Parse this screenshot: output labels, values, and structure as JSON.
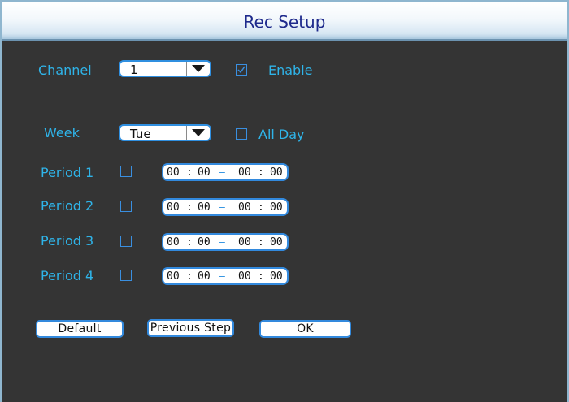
{
  "title": "Rec Setup",
  "channel": {
    "label": "Channel",
    "value": "1",
    "enable_label": "Enable",
    "enable_checked": true
  },
  "week": {
    "label": "Week",
    "value": "Tue",
    "all_day_label": "All Day",
    "all_day_checked": false
  },
  "time_separator": ":",
  "periods": [
    {
      "label": "Period 1",
      "checked": false,
      "start_h": "00",
      "start_m": "00",
      "end_h": "00",
      "end_m": "00"
    },
    {
      "label": "Period 2",
      "checked": false,
      "start_h": "00",
      "start_m": "00",
      "end_h": "00",
      "end_m": "00"
    },
    {
      "label": "Period 3",
      "checked": false,
      "start_h": "00",
      "start_m": "00",
      "end_h": "00",
      "end_m": "00"
    },
    {
      "label": "Period 4",
      "checked": false,
      "start_h": "00",
      "start_m": "00",
      "end_h": "00",
      "end_m": "00"
    }
  ],
  "buttons": {
    "default": "Default",
    "previous": "Previous Step",
    "ok": "OK"
  },
  "colors": {
    "label": "#2fb4e9",
    "border": "#3289dd",
    "title": "#1e2a8c",
    "panel": "#343434"
  },
  "icons": {
    "dropdown_arrow": "chevron-down-icon",
    "checkmark": "check-icon"
  }
}
